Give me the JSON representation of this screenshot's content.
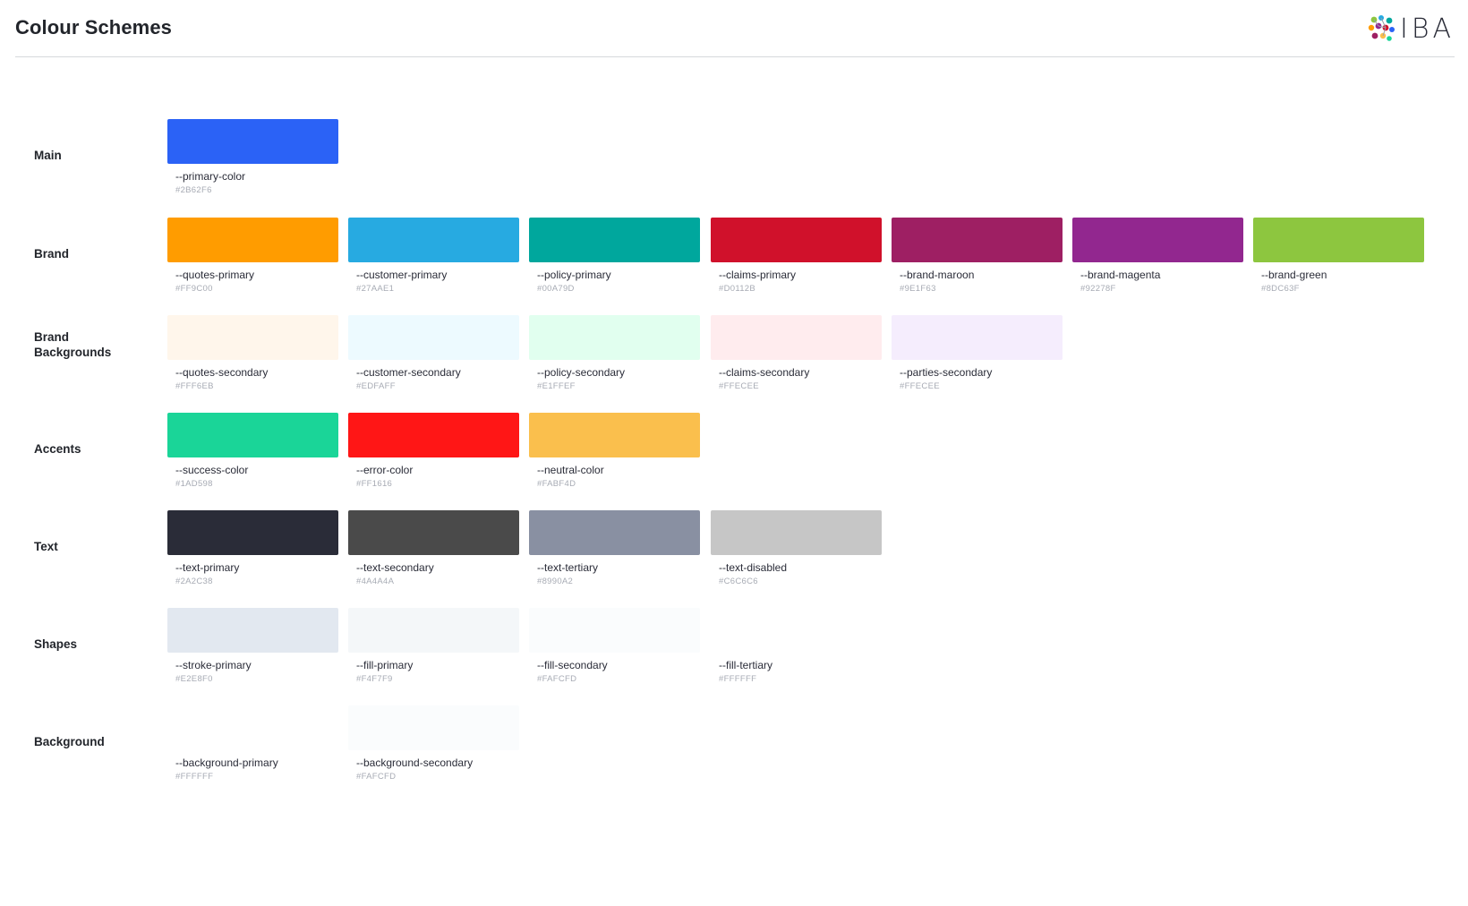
{
  "header": {
    "title": "Colour Schemes",
    "logo_text": "IBA"
  },
  "groups": [
    {
      "label": "Main",
      "swatches": [
        {
          "name": "--primary-color",
          "hex": "#2B62F6",
          "color": "#2B62F6"
        }
      ]
    },
    {
      "label": "Brand",
      "swatches": [
        {
          "name": "--quotes-primary",
          "hex": "#FF9C00",
          "color": "#FF9C00"
        },
        {
          "name": "--customer-primary",
          "hex": "#27AAE1",
          "color": "#27AAE1"
        },
        {
          "name": "--policy-primary",
          "hex": "#00A79D",
          "color": "#00A79D"
        },
        {
          "name": "--claims-primary",
          "hex": "#D0112B",
          "color": "#D0112B"
        },
        {
          "name": "--brand-maroon",
          "hex": "#9E1F63",
          "color": "#9E1F63"
        },
        {
          "name": "--brand-magenta",
          "hex": "#92278F",
          "color": "#92278F"
        },
        {
          "name": "--brand-green",
          "hex": "#8DC63F",
          "color": "#8DC63F"
        }
      ]
    },
    {
      "label": "Brand Backgrounds",
      "swatches": [
        {
          "name": "--quotes-secondary",
          "hex": "#FFF6EB",
          "color": "#FFF6EB"
        },
        {
          "name": "--customer-secondary",
          "hex": "#EDFAFF",
          "color": "#EDFAFF"
        },
        {
          "name": "--policy-secondary",
          "hex": "#E1FFEF",
          "color": "#E1FFEF"
        },
        {
          "name": "--claims-secondary",
          "hex": "#FFECEE",
          "color": "#FFECEE"
        },
        {
          "name": "--parties-secondary",
          "hex": "#FFECEE",
          "color": "#F5EDFD"
        }
      ]
    },
    {
      "label": "Accents",
      "swatches": [
        {
          "name": "--success-color",
          "hex": "#1AD598",
          "color": "#1AD598"
        },
        {
          "name": "--error-color",
          "hex": "#FF1616",
          "color": "#FF1616"
        },
        {
          "name": "--neutral-color",
          "hex": "#FABF4D",
          "color": "#FABF4D"
        }
      ]
    },
    {
      "label": "Text",
      "swatches": [
        {
          "name": "--text-primary",
          "hex": "#2A2C38",
          "color": "#2A2C38"
        },
        {
          "name": "--text-secondary",
          "hex": "#4A4A4A",
          "color": "#4A4A4A"
        },
        {
          "name": "--text-tertiary",
          "hex": "#8990A2",
          "color": "#8990A2"
        },
        {
          "name": "--text-disabled",
          "hex": "#C6C6C6",
          "color": "#C6C6C6"
        }
      ]
    },
    {
      "label": "Shapes",
      "swatches": [
        {
          "name": "--stroke-primary",
          "hex": "#E2E8F0",
          "color": "#E2E8F0"
        },
        {
          "name": "--fill-primary",
          "hex": "#F4F7F9",
          "color": "#F4F7F9"
        },
        {
          "name": "--fill-secondary",
          "hex": "#FAFCFD",
          "color": "#FAFCFD"
        },
        {
          "name": "--fill-tertiary",
          "hex": "#FFFFFF",
          "color": "#FFFFFF"
        }
      ]
    },
    {
      "label": "Background",
      "swatches": [
        {
          "name": "--background-primary",
          "hex": "#FFFFFF",
          "color": "#FFFFFF"
        },
        {
          "name": "--background-secondary",
          "hex": "#FAFCFD",
          "color": "#FAFCFD"
        }
      ]
    }
  ]
}
